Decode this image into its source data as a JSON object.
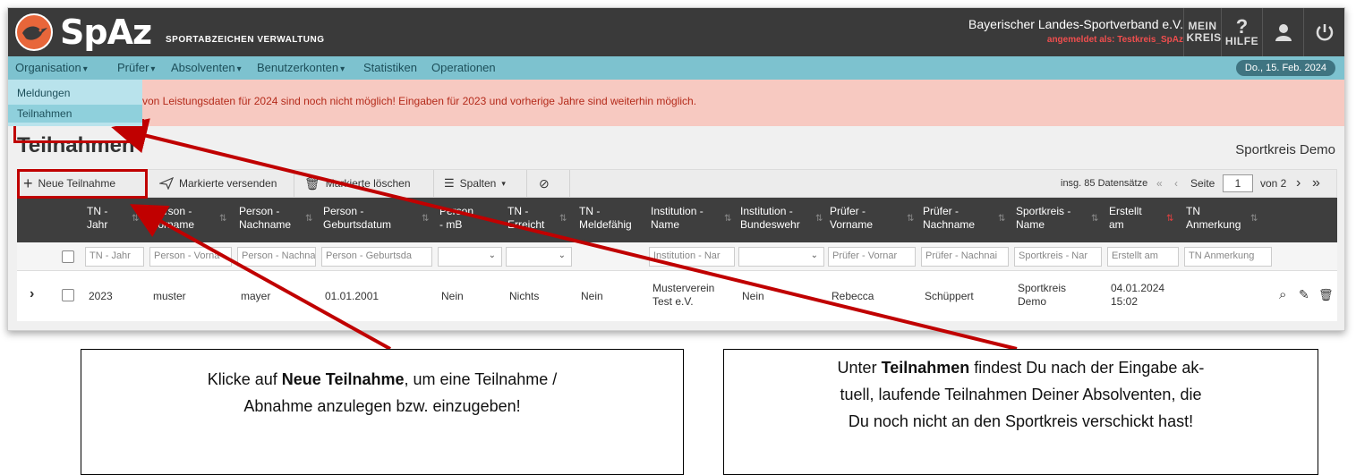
{
  "app": {
    "logo_text": "SpAz",
    "logo_subtitle": "SPORTABZEICHEN VERWALTUNG",
    "org_name": "Bayerischer Landes-Sportverband e.V.",
    "login_info": "angemeldet als: Testkreis_SpAz",
    "mein_kreis_label": "MEIN KREIS",
    "hilfe_label": "HILFE"
  },
  "menu": {
    "items": [
      {
        "label": "Organisation",
        "has_dropdown": true
      },
      {
        "label": "Prüfer",
        "has_dropdown": true
      },
      {
        "label": "Absolventen",
        "has_dropdown": true
      },
      {
        "label": "Benutzerkonten",
        "has_dropdown": true
      },
      {
        "label": "Statistiken",
        "has_dropdown": false
      },
      {
        "label": "Operationen",
        "has_dropdown": false
      }
    ],
    "date": "Do., 15. Feb. 2024",
    "dropdown": [
      "Meldungen",
      "Teilnahmen"
    ]
  },
  "warning_text": "von Leistungsdaten für 2024 sind noch nicht möglich! Eingaben für 2023 und vorherige Jahre sind weiterhin möglich.",
  "page": {
    "title": "Teilnahmen",
    "subtitle": "Sportkreis Demo"
  },
  "toolbar": {
    "new_label": "Neue Teilnahme",
    "send_label": "Markierte versenden",
    "delete_label": "Markierte löschen",
    "columns_label": "Spalten",
    "total": "insg. 85 Datensätze",
    "page_label": "Seite",
    "page": "1",
    "of_pages": "von 2"
  },
  "table": {
    "headers": [
      [
        "TN -",
        "Jahr"
      ],
      [
        "Person -",
        "Vorname"
      ],
      [
        "Person -",
        "Nachname"
      ],
      [
        "Person -",
        "Geburtsdatum"
      ],
      [
        "Person",
        "- mB"
      ],
      [
        "TN -",
        "Erreicht"
      ],
      [
        "TN -",
        "Meldefähig"
      ],
      [
        "Institution -",
        "Name"
      ],
      [
        "Institution -",
        "Bundeswehr"
      ],
      [
        "Prüfer -",
        "Vorname"
      ],
      [
        "Prüfer -",
        "Nachname"
      ],
      [
        "Sportkreis -",
        "Name"
      ],
      [
        "Erstellt",
        "am"
      ],
      [
        "TN",
        "Anmerkung"
      ]
    ],
    "filters": [
      "TN - Jahr",
      "Person - Vorna",
      "Person - Nachna",
      "Person - Geburtsda",
      "",
      "",
      "",
      "Institution - Nar",
      "",
      "Prüfer - Vornar",
      "Prüfer - Nachnai",
      "Sportkreis - Nar",
      "Erstellt am",
      "TN Anmerkung"
    ],
    "row": {
      "jahr": "2023",
      "vorname": "muster",
      "nachname": "mayer",
      "geburtsdatum": "01.01.2001",
      "mb": "Nein",
      "erreicht": "Nichts",
      "meldefaehig": "Nein",
      "institution_1": "Musterverein",
      "institution_2": "Test e.V.",
      "bundeswehr": "Nein",
      "pruefer_vorname": "Rebecca",
      "pruefer_nachname": "Schüppert",
      "sportkreis_1": "Sportkreis",
      "sportkreis_2": "Demo",
      "erstellt_1": "04.01.2024",
      "erstellt_2": "15:02",
      "anmerkung": ""
    }
  },
  "callouts": {
    "left": {
      "pre": "Klicke auf ",
      "bold": "Neue Teilnahme",
      "post": ", um eine Teilnahme /",
      "line2": "Abnahme anzulegen bzw. einzugeben!"
    },
    "right": {
      "pre": "Unter ",
      "bold": "Teilnahmen",
      "post": " findest Du nach der Eingabe ak-",
      "line2": "tuell, laufende Teilnahmen Deiner Absolventen, die",
      "line3": "Du noch nicht an den Sportkreis verschickt hast!"
    }
  },
  "colors": {
    "topbar": "#3a3a3a",
    "menubar": "#7dc2cf",
    "warning_bg": "#f7c9c1",
    "highlight": "#c00000",
    "brand_orange": "#e8663a"
  }
}
